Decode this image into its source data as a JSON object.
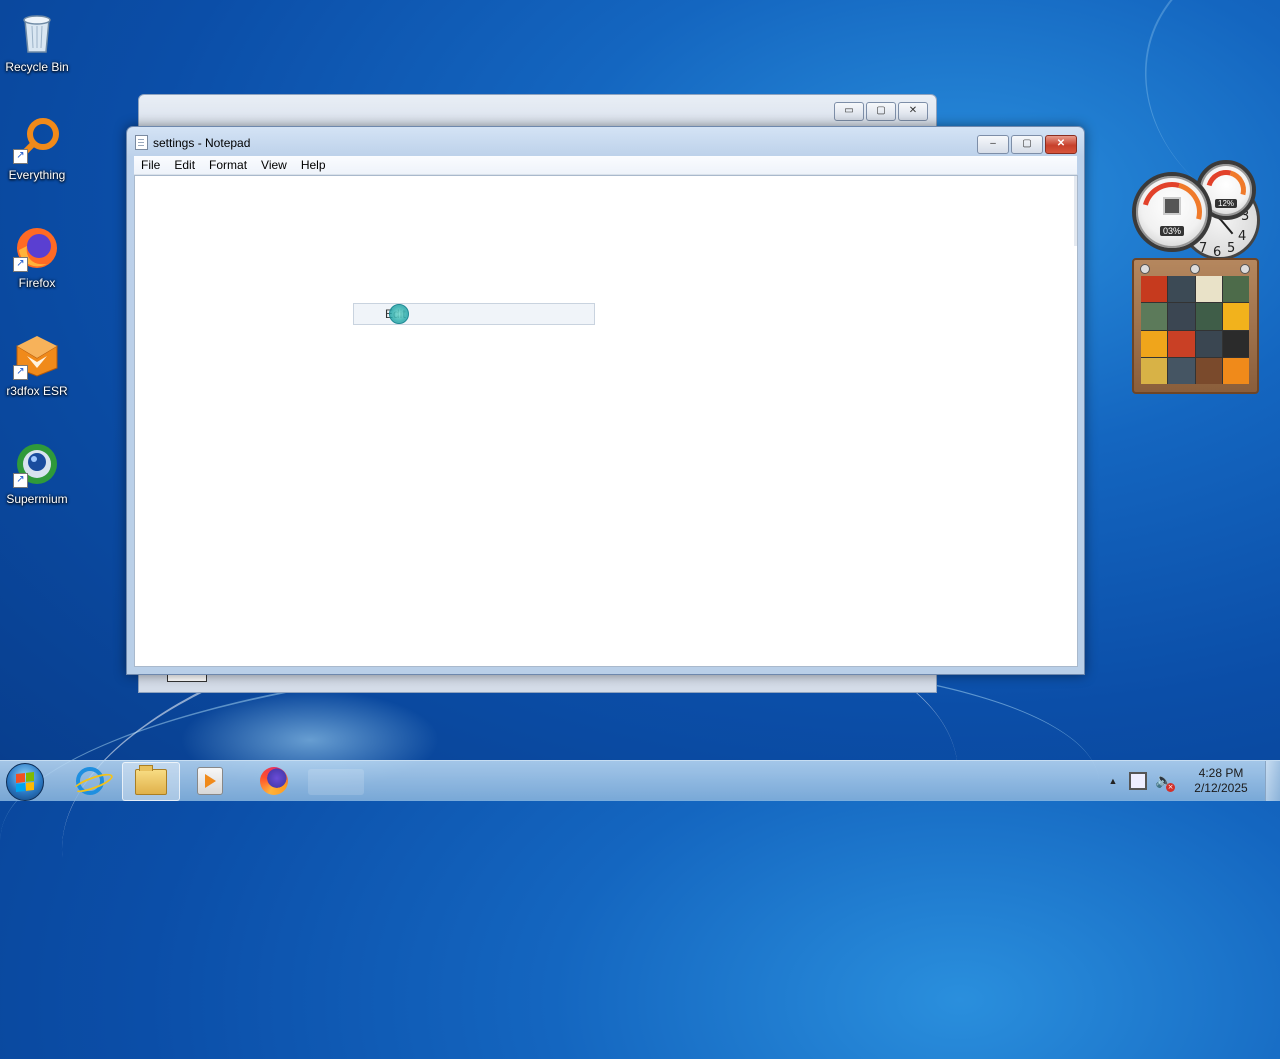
{
  "desktop": {
    "icons": [
      {
        "label": "Recycle Bin",
        "icon": "recycle-bin-icon"
      },
      {
        "label": "Everything",
        "icon": "everything-search-icon"
      },
      {
        "label": "Firefox",
        "icon": "firefox-icon"
      },
      {
        "label": "r3dfox ESR",
        "icon": "r3dfox-icon"
      },
      {
        "label": "Supermium",
        "icon": "supermium-icon"
      }
    ]
  },
  "back_window": {
    "controls": {
      "minimize": "▭",
      "maximize": "▢",
      "close": "✕"
    }
  },
  "notepad": {
    "title": "settings - Notepad",
    "menu": [
      "File",
      "Edit",
      "Format",
      "View",
      "Help"
    ],
    "controls": {
      "minimize": "‒",
      "maximize": "▢",
      "close": "✕"
    },
    "drag_label": "Edit"
  },
  "gadgets": {
    "cpu_percent": "03%",
    "memory_percent": "12%",
    "clock_numbers": [
      "3",
      "4",
      "5",
      "6",
      "7"
    ]
  },
  "taskbar": {
    "pinned": [
      "internet-explorer-icon",
      "windows-explorer-icon",
      "media-player-icon",
      "firefox-icon"
    ],
    "clock_time": "4:28 PM",
    "clock_date": "2/12/2025",
    "tray_arrow": "▲"
  },
  "colors": {
    "desktop_bg": "#1466c0",
    "close_button": "#c7402c",
    "taskbar": "#a9cbea"
  }
}
